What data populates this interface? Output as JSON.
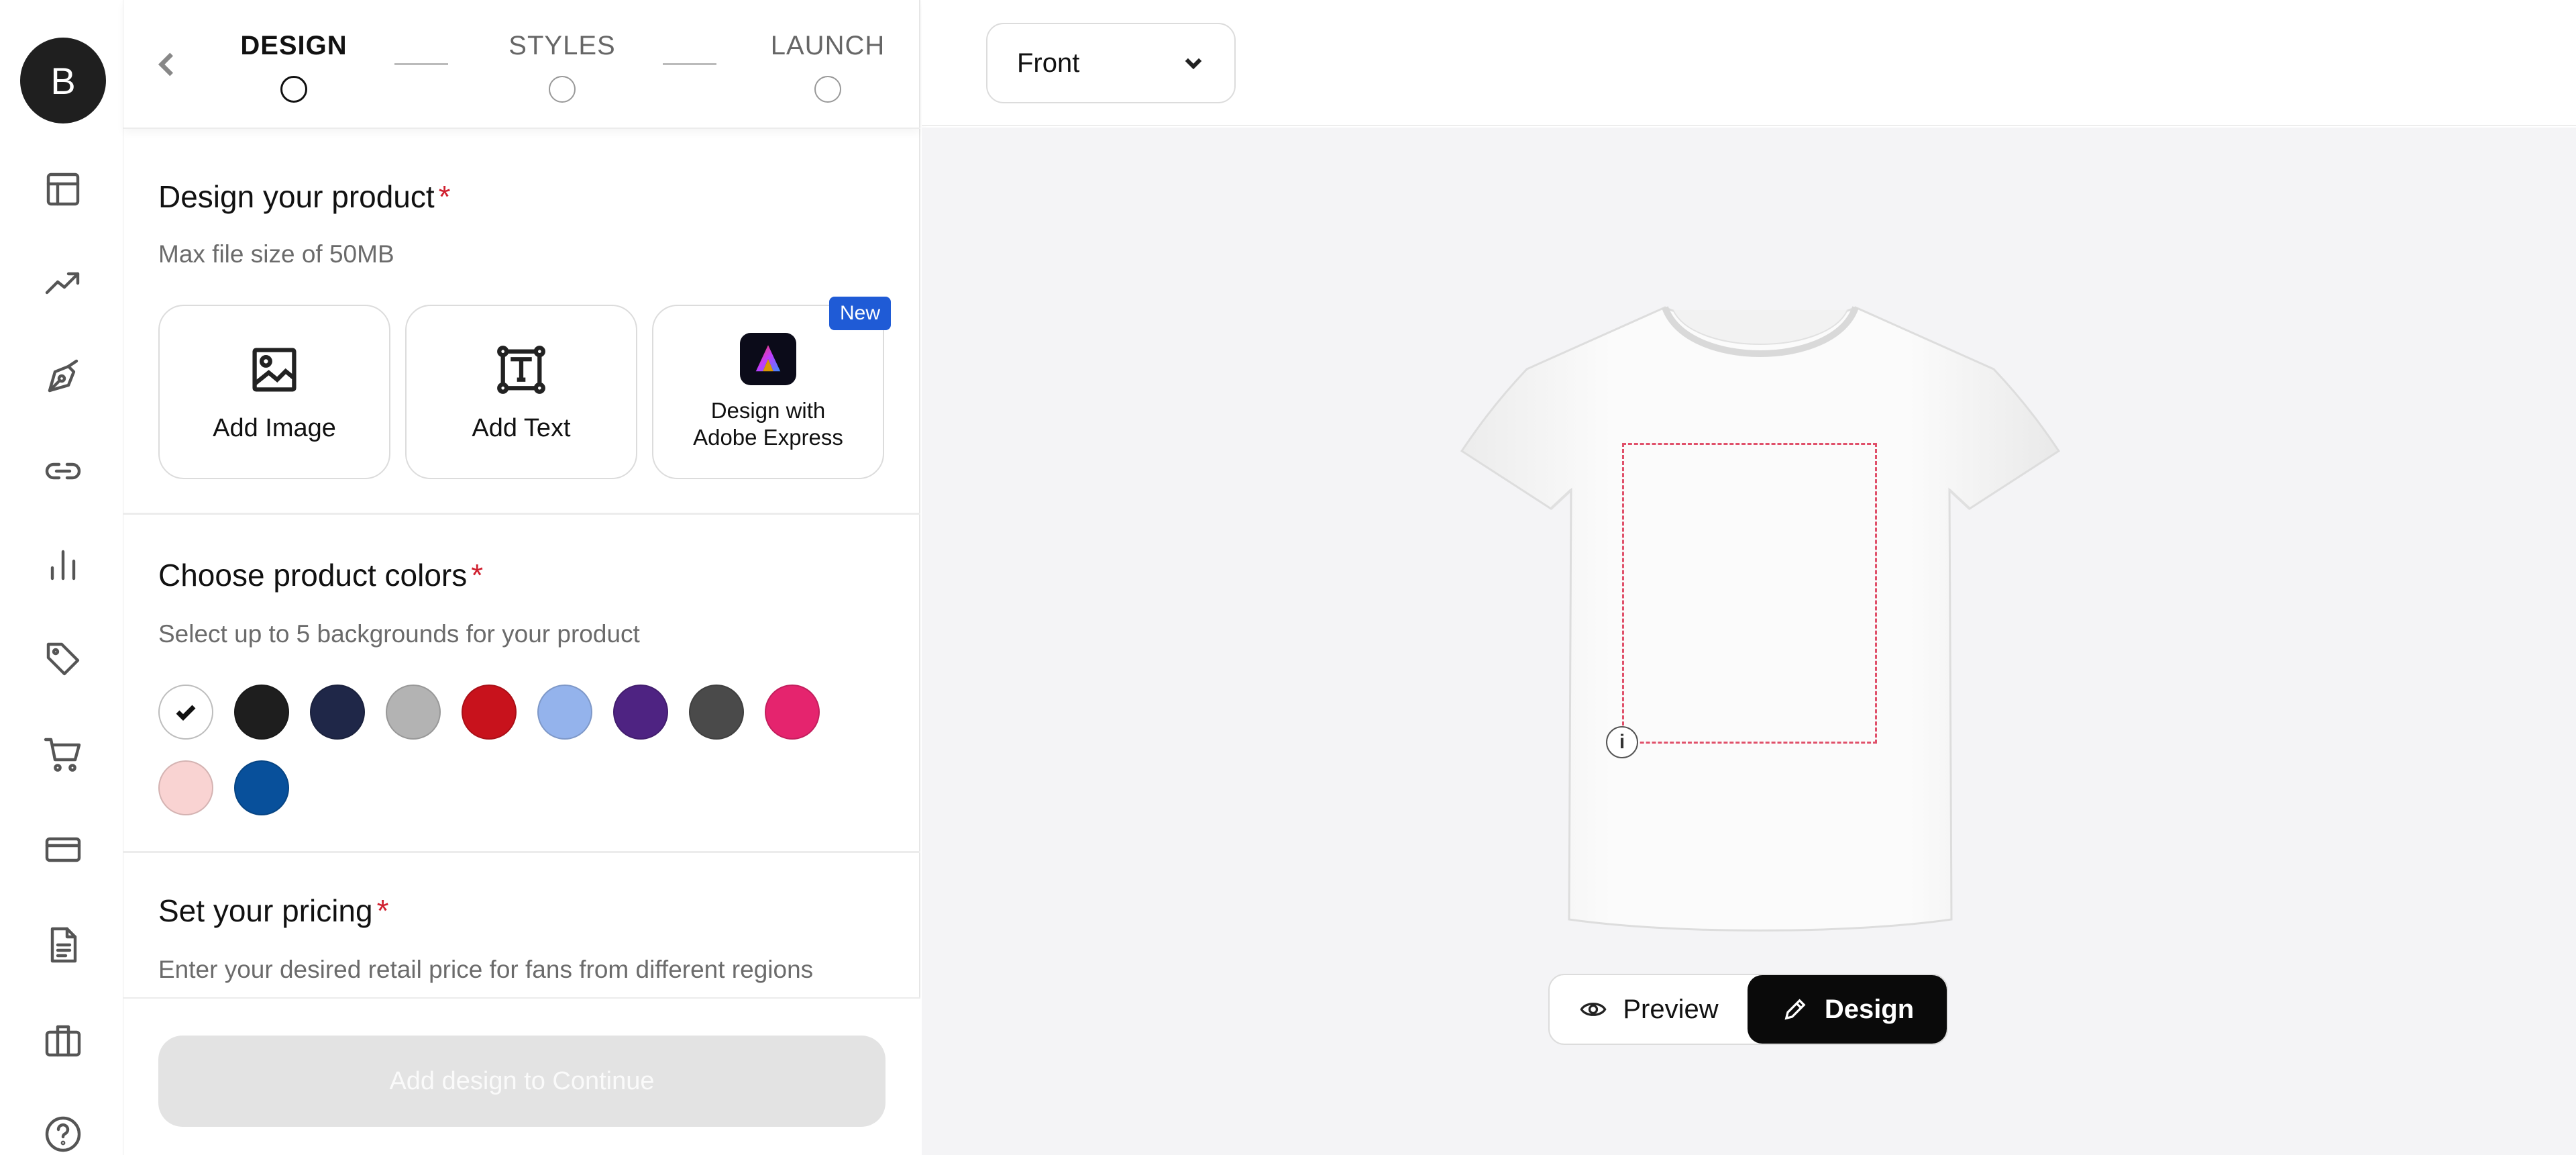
{
  "user": {
    "avatar_initial": "B"
  },
  "rail_icons": [
    "layout-icon",
    "trending-icon",
    "pen-tool-icon",
    "link-icon",
    "bar-chart-icon",
    "tag-icon",
    "cart-icon",
    "credit-card-icon",
    "document-icon",
    "briefcase-icon",
    "help-icon"
  ],
  "stepper": {
    "steps": [
      {
        "label": "DESIGN",
        "active": true
      },
      {
        "label": "STYLES",
        "active": false
      },
      {
        "label": "LAUNCH",
        "active": false
      }
    ]
  },
  "design_section": {
    "title": "Design your product",
    "required_mark": "*",
    "subtitle": "Max file size of 50MB",
    "options": [
      {
        "label": "Add Image",
        "icon": "image-icon"
      },
      {
        "label": "Add Text",
        "icon": "text-box-icon"
      },
      {
        "label": "Design with Adobe Express",
        "icon": "adobe-express-icon",
        "badge": "New"
      }
    ]
  },
  "colors_section": {
    "title": "Choose product colors",
    "required_mark": "*",
    "subtitle": "Select up to 5 backgrounds for your product",
    "swatches": [
      {
        "color": "#ffffff",
        "selected": true
      },
      {
        "color": "#1e1e1e",
        "selected": false
      },
      {
        "color": "#1f2748",
        "selected": false
      },
      {
        "color": "#b3b3b3",
        "selected": false
      },
      {
        "color": "#c8121c",
        "selected": false
      },
      {
        "color": "#94b3ec",
        "selected": false
      },
      {
        "color": "#4e2382",
        "selected": false
      },
      {
        "color": "#4a4a4a",
        "selected": false
      },
      {
        "color": "#e5246e",
        "selected": false
      },
      {
        "color": "#f9d3d2",
        "selected": false
      },
      {
        "color": "#08509b",
        "selected": false
      }
    ]
  },
  "pricing_section": {
    "title": "Set your pricing",
    "required_mark": "*",
    "subtitle": "Enter your desired retail price for fans from different regions"
  },
  "footer": {
    "continue_label": "Add design to Continue"
  },
  "canvas": {
    "view_selector": "Front",
    "mode_toggle": {
      "preview_label": "Preview",
      "design_label": "Design",
      "active": "Design"
    },
    "info_glyph": "i"
  },
  "colors": {
    "accent": "#1f5bd6",
    "required": "#d0202f",
    "print_area_border": "#e0506a"
  }
}
